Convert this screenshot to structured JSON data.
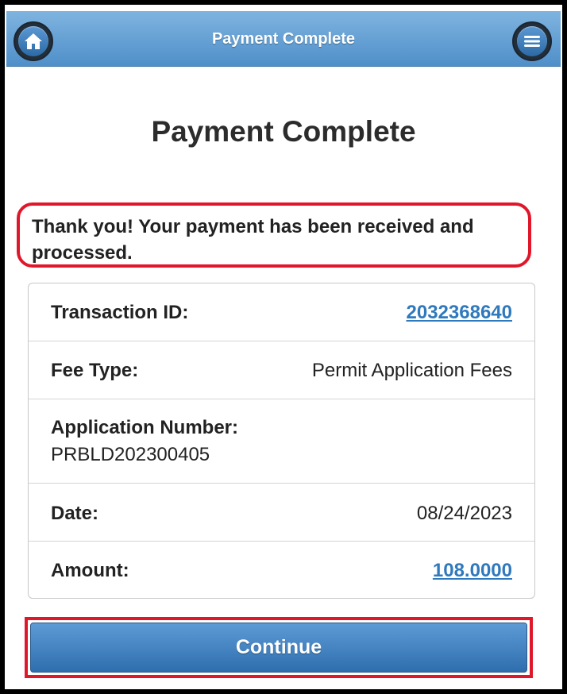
{
  "header": {
    "title": "Payment Complete",
    "home_icon": "home-icon",
    "menu_icon": "menu-icon"
  },
  "page": {
    "title": "Payment Complete",
    "message": "Thank you! Your payment has been received and processed."
  },
  "details": {
    "transaction_id_label": "Transaction ID:",
    "transaction_id_value": "2032368640",
    "fee_type_label": "Fee Type:",
    "fee_type_value": "Permit Application Fees",
    "application_number_label": "Application Number:",
    "application_number_value": "PRBLD202300405",
    "date_label": "Date:",
    "date_value": "08/24/2023",
    "amount_label": "Amount:",
    "amount_value": "108.0000"
  },
  "actions": {
    "continue_label": "Continue"
  },
  "colors": {
    "header_blue": "#5b98d4",
    "link_blue": "#2f79bd",
    "highlight_red": "#e0172a"
  }
}
